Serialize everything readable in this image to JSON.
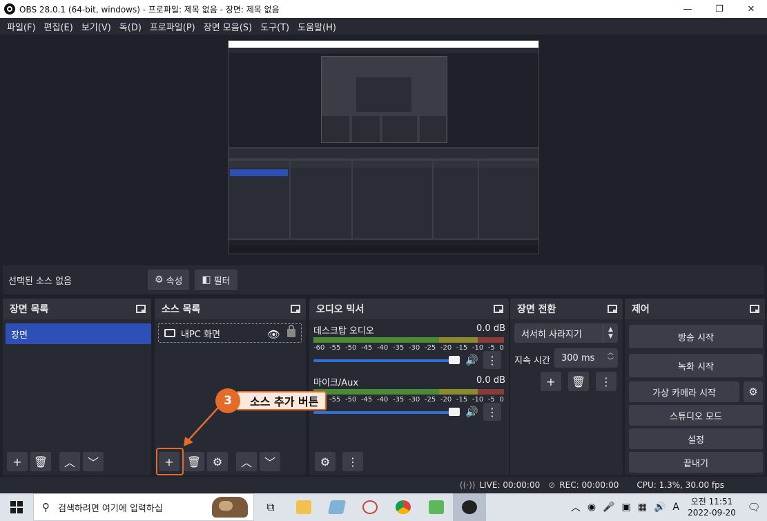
{
  "window": {
    "title": "OBS 28.0.1 (64-bit, windows) - 프로파일: 제목 없음 - 장면: 제목 없음",
    "minimize": "—",
    "maximize": "❐",
    "close": "✕"
  },
  "menu": [
    "파일(F)",
    "편집(E)",
    "보기(V)",
    "독(D)",
    "프로파일(P)",
    "장면 모음(S)",
    "도구(T)",
    "도움말(H)"
  ],
  "selection_bar": {
    "label": "선택된 소스 없음",
    "properties": "속성",
    "filters": "필터"
  },
  "scenes": {
    "title": "장면 목록",
    "items": [
      "장면"
    ]
  },
  "sources": {
    "title": "소스 목록",
    "items": [
      "내PC 화면"
    ]
  },
  "mixer": {
    "title": "오디오 믹서",
    "channels": [
      {
        "name": "데스크탑 오디오",
        "level": "0.0 dB"
      },
      {
        "name": "마이크/Aux",
        "level": "0.0 dB"
      }
    ],
    "scale": [
      "-60",
      "-55",
      "-50",
      "-45",
      "-40",
      "-35",
      "-30",
      "-25",
      "-20",
      "-15",
      "-10",
      "-5",
      "0"
    ]
  },
  "transitions": {
    "title": "장면 전환",
    "selected": "서서히 사라지기",
    "duration_label": "지속 시간",
    "duration_value": "300 ms"
  },
  "controls": {
    "title": "제어",
    "start_streaming": "방송 시작",
    "start_recording": "녹화 시작",
    "start_virtual_cam": "가상 카메라 시작",
    "studio_mode": "스튜디오 모드",
    "settings": "설정",
    "exit": "끝내기"
  },
  "status": {
    "live": "LIVE: 00:00:00",
    "rec": "REC: 00:00:00",
    "cpu": "CPU: 1.3%, 30.00 fps"
  },
  "callout": {
    "number": "3",
    "text": "소스 추가 버튼"
  },
  "taskbar": {
    "search_placeholder": "검색하려면 여기에 입력하십",
    "time": "오전 11:51",
    "date": "2022-09-20",
    "ime": "A"
  },
  "colors": {
    "accent": "#2e4fb5",
    "callout": "#e46b2a"
  }
}
